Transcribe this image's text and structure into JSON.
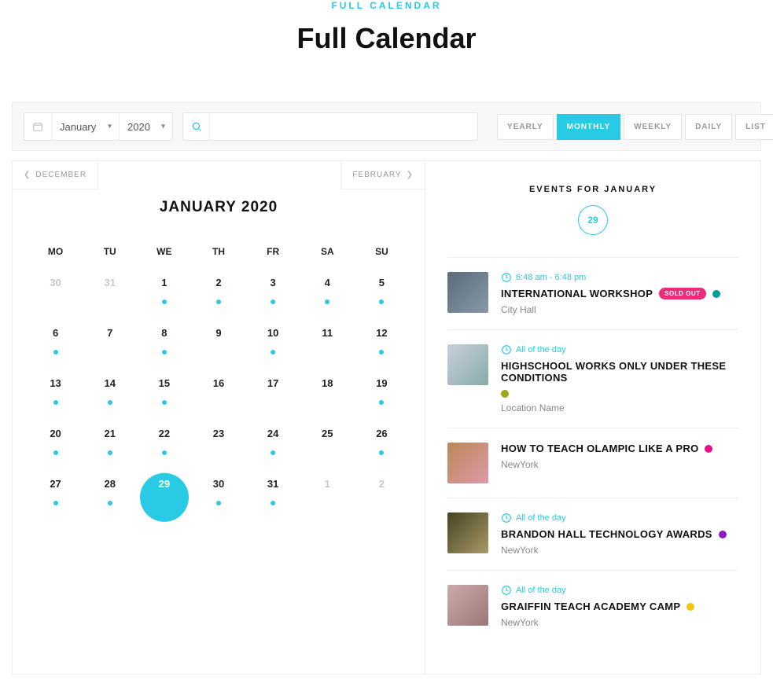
{
  "header": {
    "eyebrow": "FULL CALENDAR",
    "title": "Full Calendar"
  },
  "toolbar": {
    "month_options": [
      "January"
    ],
    "month_value": "January",
    "year_options": [
      "2020"
    ],
    "year_value": "2020",
    "search_placeholder": ""
  },
  "views": [
    {
      "label": "YEARLY",
      "active": false
    },
    {
      "label": "MONTHLY",
      "active": true
    },
    {
      "label": "WEEKLY",
      "active": false
    },
    {
      "label": "DAILY",
      "active": false
    },
    {
      "label": "LIST",
      "active": false
    }
  ],
  "calendar": {
    "prev_label": "DECEMBER",
    "next_label": "FEBRUARY",
    "title": "JANUARY 2020",
    "dow": [
      "MO",
      "TU",
      "WE",
      "TH",
      "FR",
      "SA",
      "SU"
    ],
    "selected_day": "29",
    "cells": [
      {
        "n": "30",
        "other": true
      },
      {
        "n": "31",
        "other": true
      },
      {
        "n": "1",
        "dot": true
      },
      {
        "n": "2",
        "dot": true
      },
      {
        "n": "3",
        "dot": true
      },
      {
        "n": "4",
        "dot": true
      },
      {
        "n": "5",
        "dot": true
      },
      {
        "n": "6",
        "dot": true
      },
      {
        "n": "7"
      },
      {
        "n": "8",
        "dot": true
      },
      {
        "n": "9"
      },
      {
        "n": "10",
        "dot": true
      },
      {
        "n": "11"
      },
      {
        "n": "12",
        "dot": true
      },
      {
        "n": "13",
        "dot": true
      },
      {
        "n": "14",
        "dot": true
      },
      {
        "n": "15",
        "dot": true
      },
      {
        "n": "16"
      },
      {
        "n": "17"
      },
      {
        "n": "18"
      },
      {
        "n": "19",
        "dot": true
      },
      {
        "n": "20",
        "dot": true
      },
      {
        "n": "21",
        "dot": true
      },
      {
        "n": "22",
        "dot": true
      },
      {
        "n": "23"
      },
      {
        "n": "24",
        "dot": true
      },
      {
        "n": "25"
      },
      {
        "n": "26",
        "dot": true
      },
      {
        "n": "27",
        "dot": true
      },
      {
        "n": "28",
        "dot": true
      },
      {
        "n": "29",
        "dot": true,
        "selected": true
      },
      {
        "n": "30",
        "dot": true
      },
      {
        "n": "31",
        "dot": true
      },
      {
        "n": "1",
        "other": true
      },
      {
        "n": "2",
        "other": true
      }
    ]
  },
  "events_panel": {
    "title": "EVENTS FOR JANUARY",
    "day": "29",
    "items": [
      {
        "time": "6:48 am - 6:48 pm",
        "name": "INTERNATIONAL WORKSHOP",
        "badge": "SOLD OUT",
        "tag_color": "#009d99",
        "location": "City Hall",
        "thumb": "th1"
      },
      {
        "time": "All of the day",
        "name": "HIGHSCHOOL WORKS ONLY UNDER THESE CONDITIONS",
        "tag_color": "#9ea91a",
        "location": "Location Name",
        "thumb": "th2"
      },
      {
        "time": "",
        "name": "HOW TO TEACH OLAMPIC LIKE A PRO",
        "tag_color": "#ea0e88",
        "location": "NewYork",
        "thumb": "th3"
      },
      {
        "time": "All of the day",
        "name": "BRANDON HALL TECHNOLOGY AWARDS",
        "tag_color": "#8b1cc6",
        "location": "NewYork",
        "thumb": "th4"
      },
      {
        "time": "All of the day",
        "name": "GRAIFFIN TEACH ACADEMY CAMP",
        "tag_color": "#f4c513",
        "location": "NewYork",
        "thumb": "th5"
      }
    ]
  }
}
